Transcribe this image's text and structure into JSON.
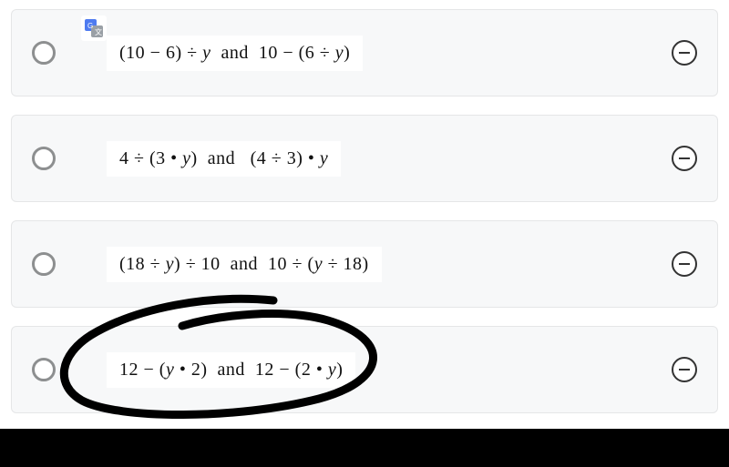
{
  "options": [
    {
      "expr_html": "(10 − 6) ÷ <span class='it'>y</span> &nbsp;and&nbsp; 10 − (6 ÷ <span class='it'>y</span>)"
    },
    {
      "expr_html": "4 ÷ (3 • <span class='it'>y</span>) &nbsp;and &nbsp; (4 ÷ 3) • <span class='it'>y</span>"
    },
    {
      "expr_html": "(18 ÷ <span class='it'>y</span>) ÷ 10 &nbsp;and&nbsp; 10 ÷ (<span class='it'>y</span> ÷ 18)"
    },
    {
      "expr_html": "12 − (<span class='it'>y</span> • 2) &nbsp;and&nbsp; 12 − (2 • <span class='it'>y</span>)"
    }
  ],
  "circled_option_index": 3
}
